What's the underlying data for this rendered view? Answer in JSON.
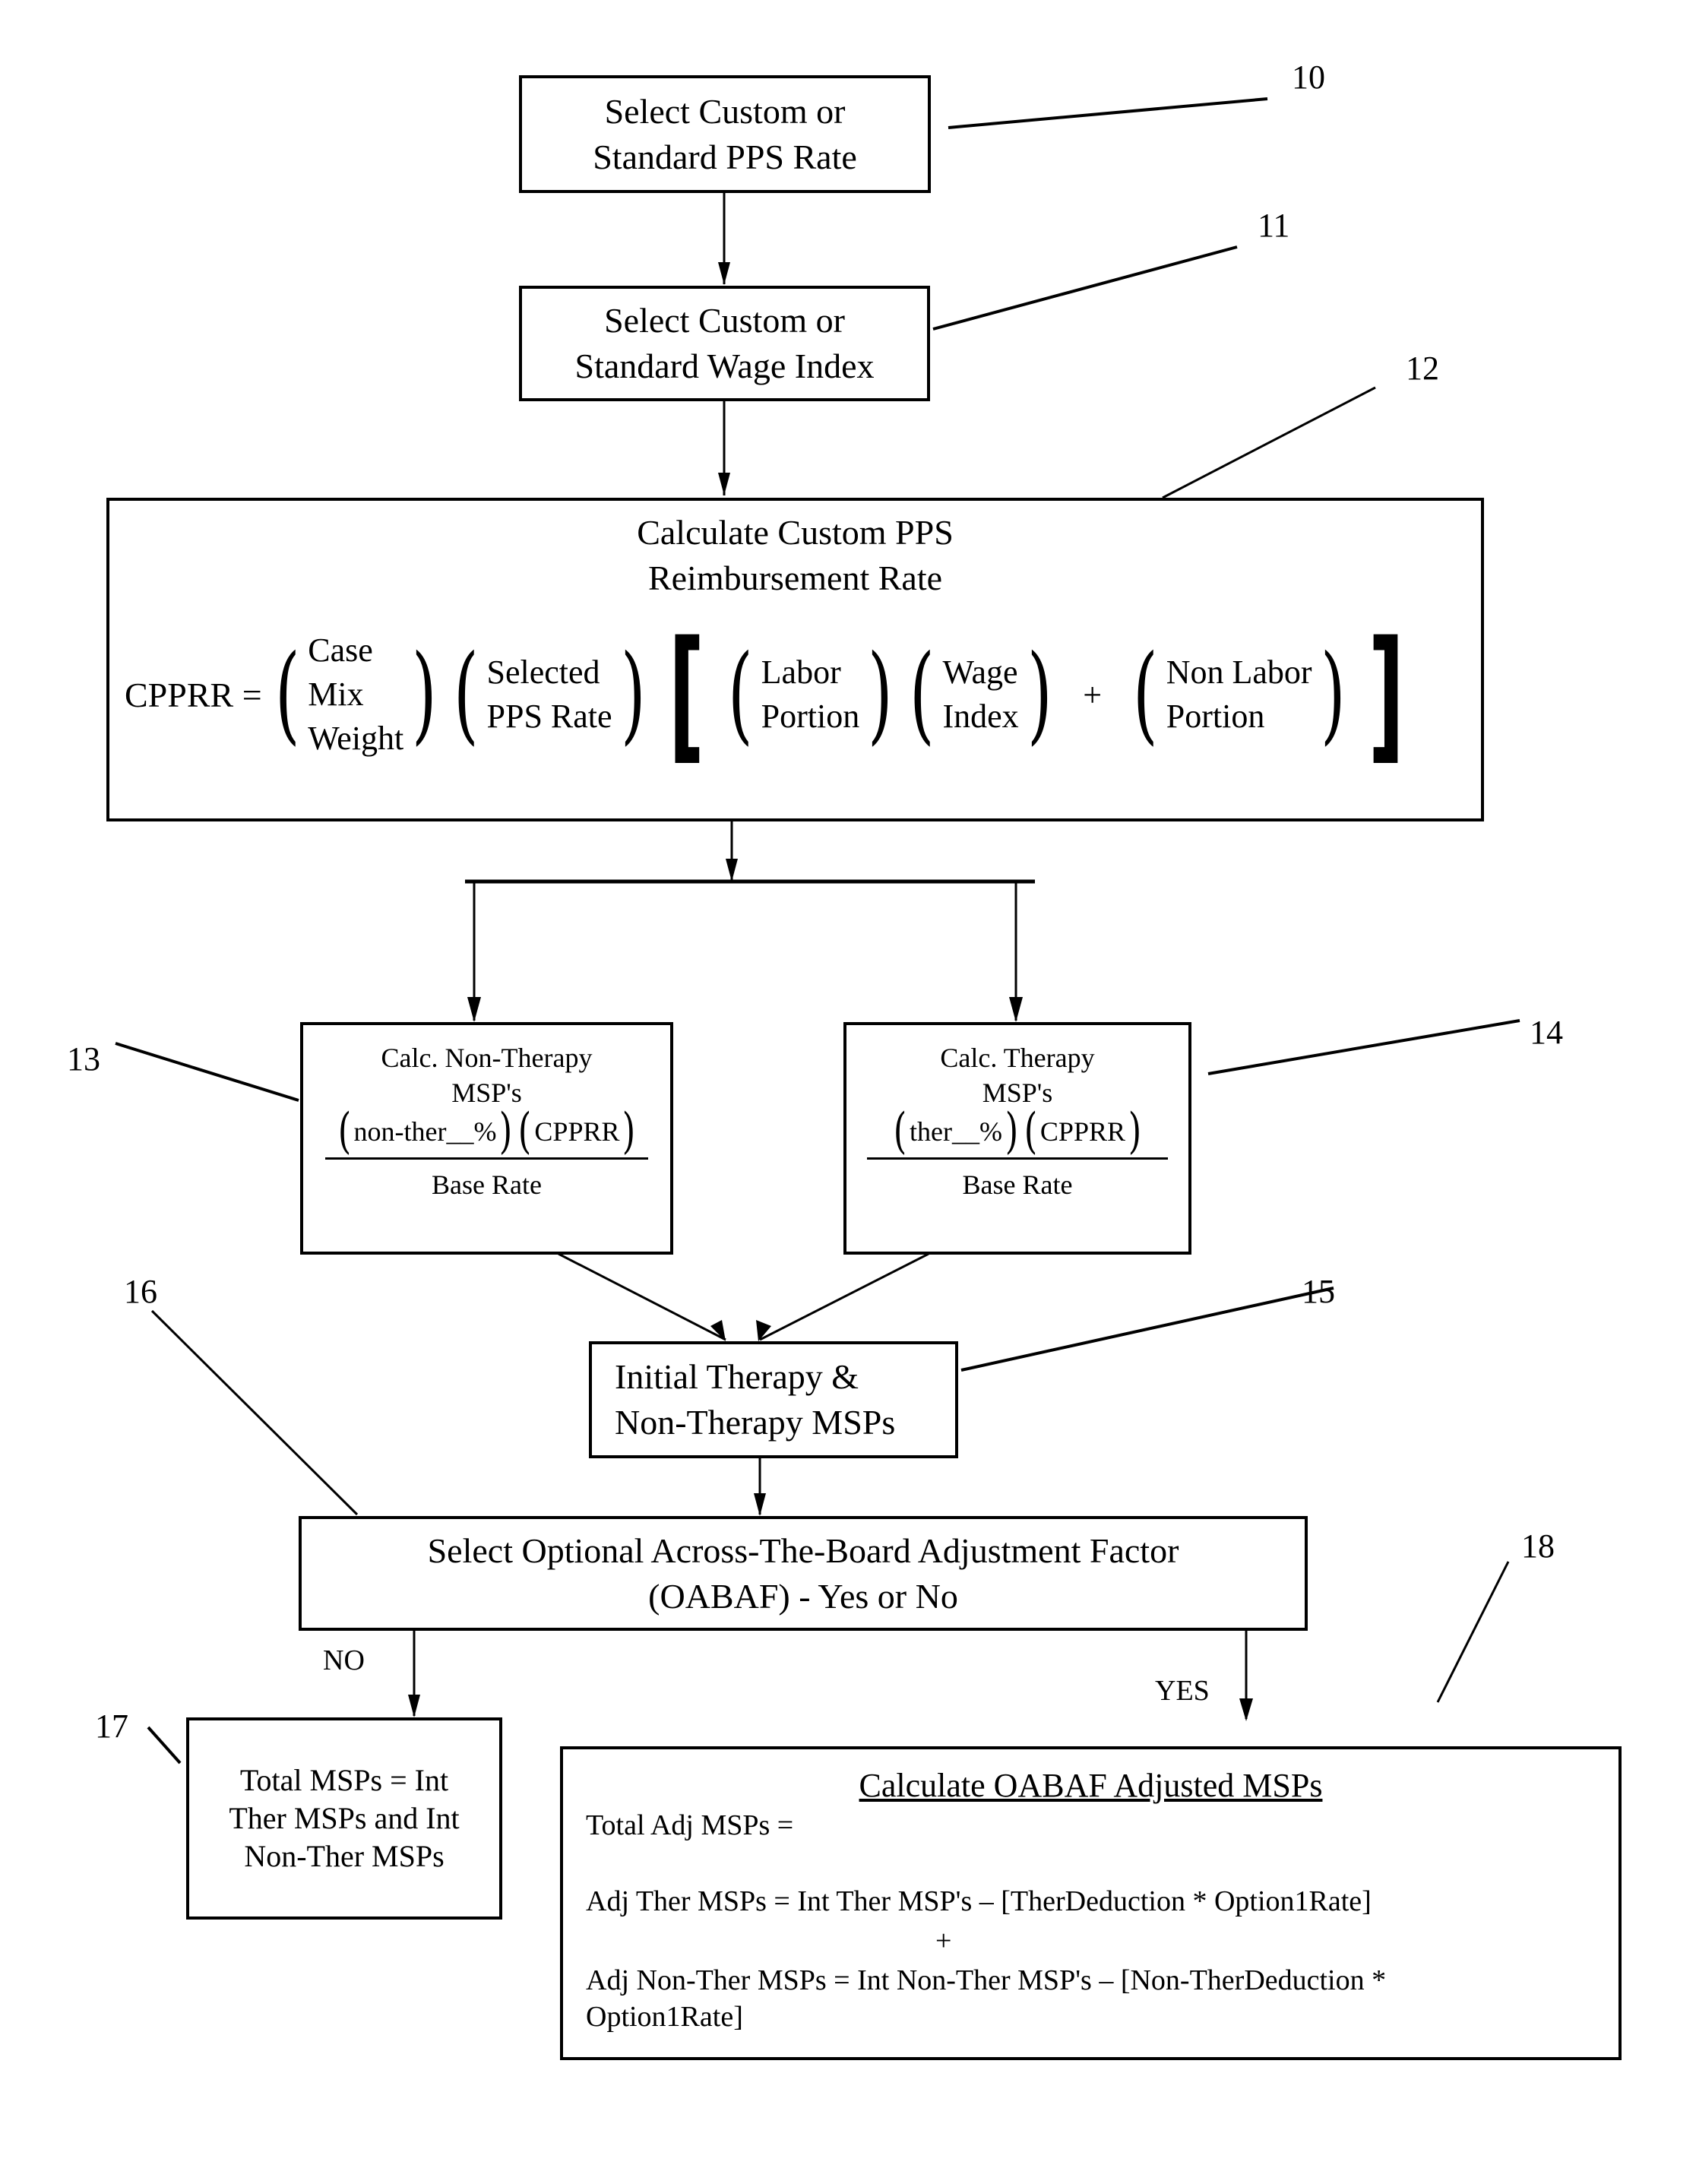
{
  "flowchart": {
    "step_10": {
      "ref": "10",
      "lines": [
        "Select Custom or",
        "Standard PPS Rate"
      ]
    },
    "step_11": {
      "ref": "11",
      "lines": [
        "Select Custom or",
        "Standard Wage Index"
      ]
    },
    "step_12": {
      "ref": "12",
      "title_lines": [
        "Calculate Custom PPS",
        "Reimbursement Rate"
      ],
      "formula": {
        "lhs": "CPPRR =",
        "term_case_mix": [
          "Case",
          "Mix",
          "Weight"
        ],
        "term_selected_rate": [
          "Selected",
          "PPS Rate"
        ],
        "term_labor": [
          "Labor",
          "Portion"
        ],
        "term_wage": [
          "Wage",
          "Index"
        ],
        "plus": "+",
        "term_non_labor": [
          "Non Labor",
          "Portion"
        ]
      }
    },
    "step_13": {
      "ref": "13",
      "title_lines": [
        "Calc. Non-Therapy",
        "MSP's"
      ],
      "numerator_a": "non-ther__%",
      "numerator_b": "CPPRR",
      "denominator": "Base Rate"
    },
    "step_14": {
      "ref": "14",
      "title_lines": [
        "Calc. Therapy",
        "MSP's"
      ],
      "numerator_a": "ther__%",
      "numerator_b": "CPPRR",
      "denominator": "Base Rate"
    },
    "step_15": {
      "ref": "15",
      "lines": [
        "Initial Therapy &",
        "Non-Therapy MSPs"
      ]
    },
    "step_16": {
      "ref": "16",
      "lines": [
        "Select Optional Across-The-Board Adjustment Factor",
        "(OABAF) - Yes or No"
      ]
    },
    "branch_no": "NO",
    "branch_yes": "YES",
    "step_17": {
      "ref": "17",
      "lines": [
        "Total MSPs = Int",
        "Ther MSPs and Int",
        "Non-Ther MSPs"
      ]
    },
    "step_18": {
      "ref": "18",
      "title": "Calculate OABAF Adjusted MSPs",
      "total_line": "Total Adj MSPs =",
      "ther_line": "Adj Ther MSPs  = Int Ther MSP's – [TherDeduction *  Option1Rate]",
      "plus": "+",
      "non_ther_line_1": "Adj Non-Ther MSPs  =  Int Non-Ther MSP's – [Non-TherDeduction *",
      "non_ther_line_2": "Option1Rate]"
    }
  }
}
